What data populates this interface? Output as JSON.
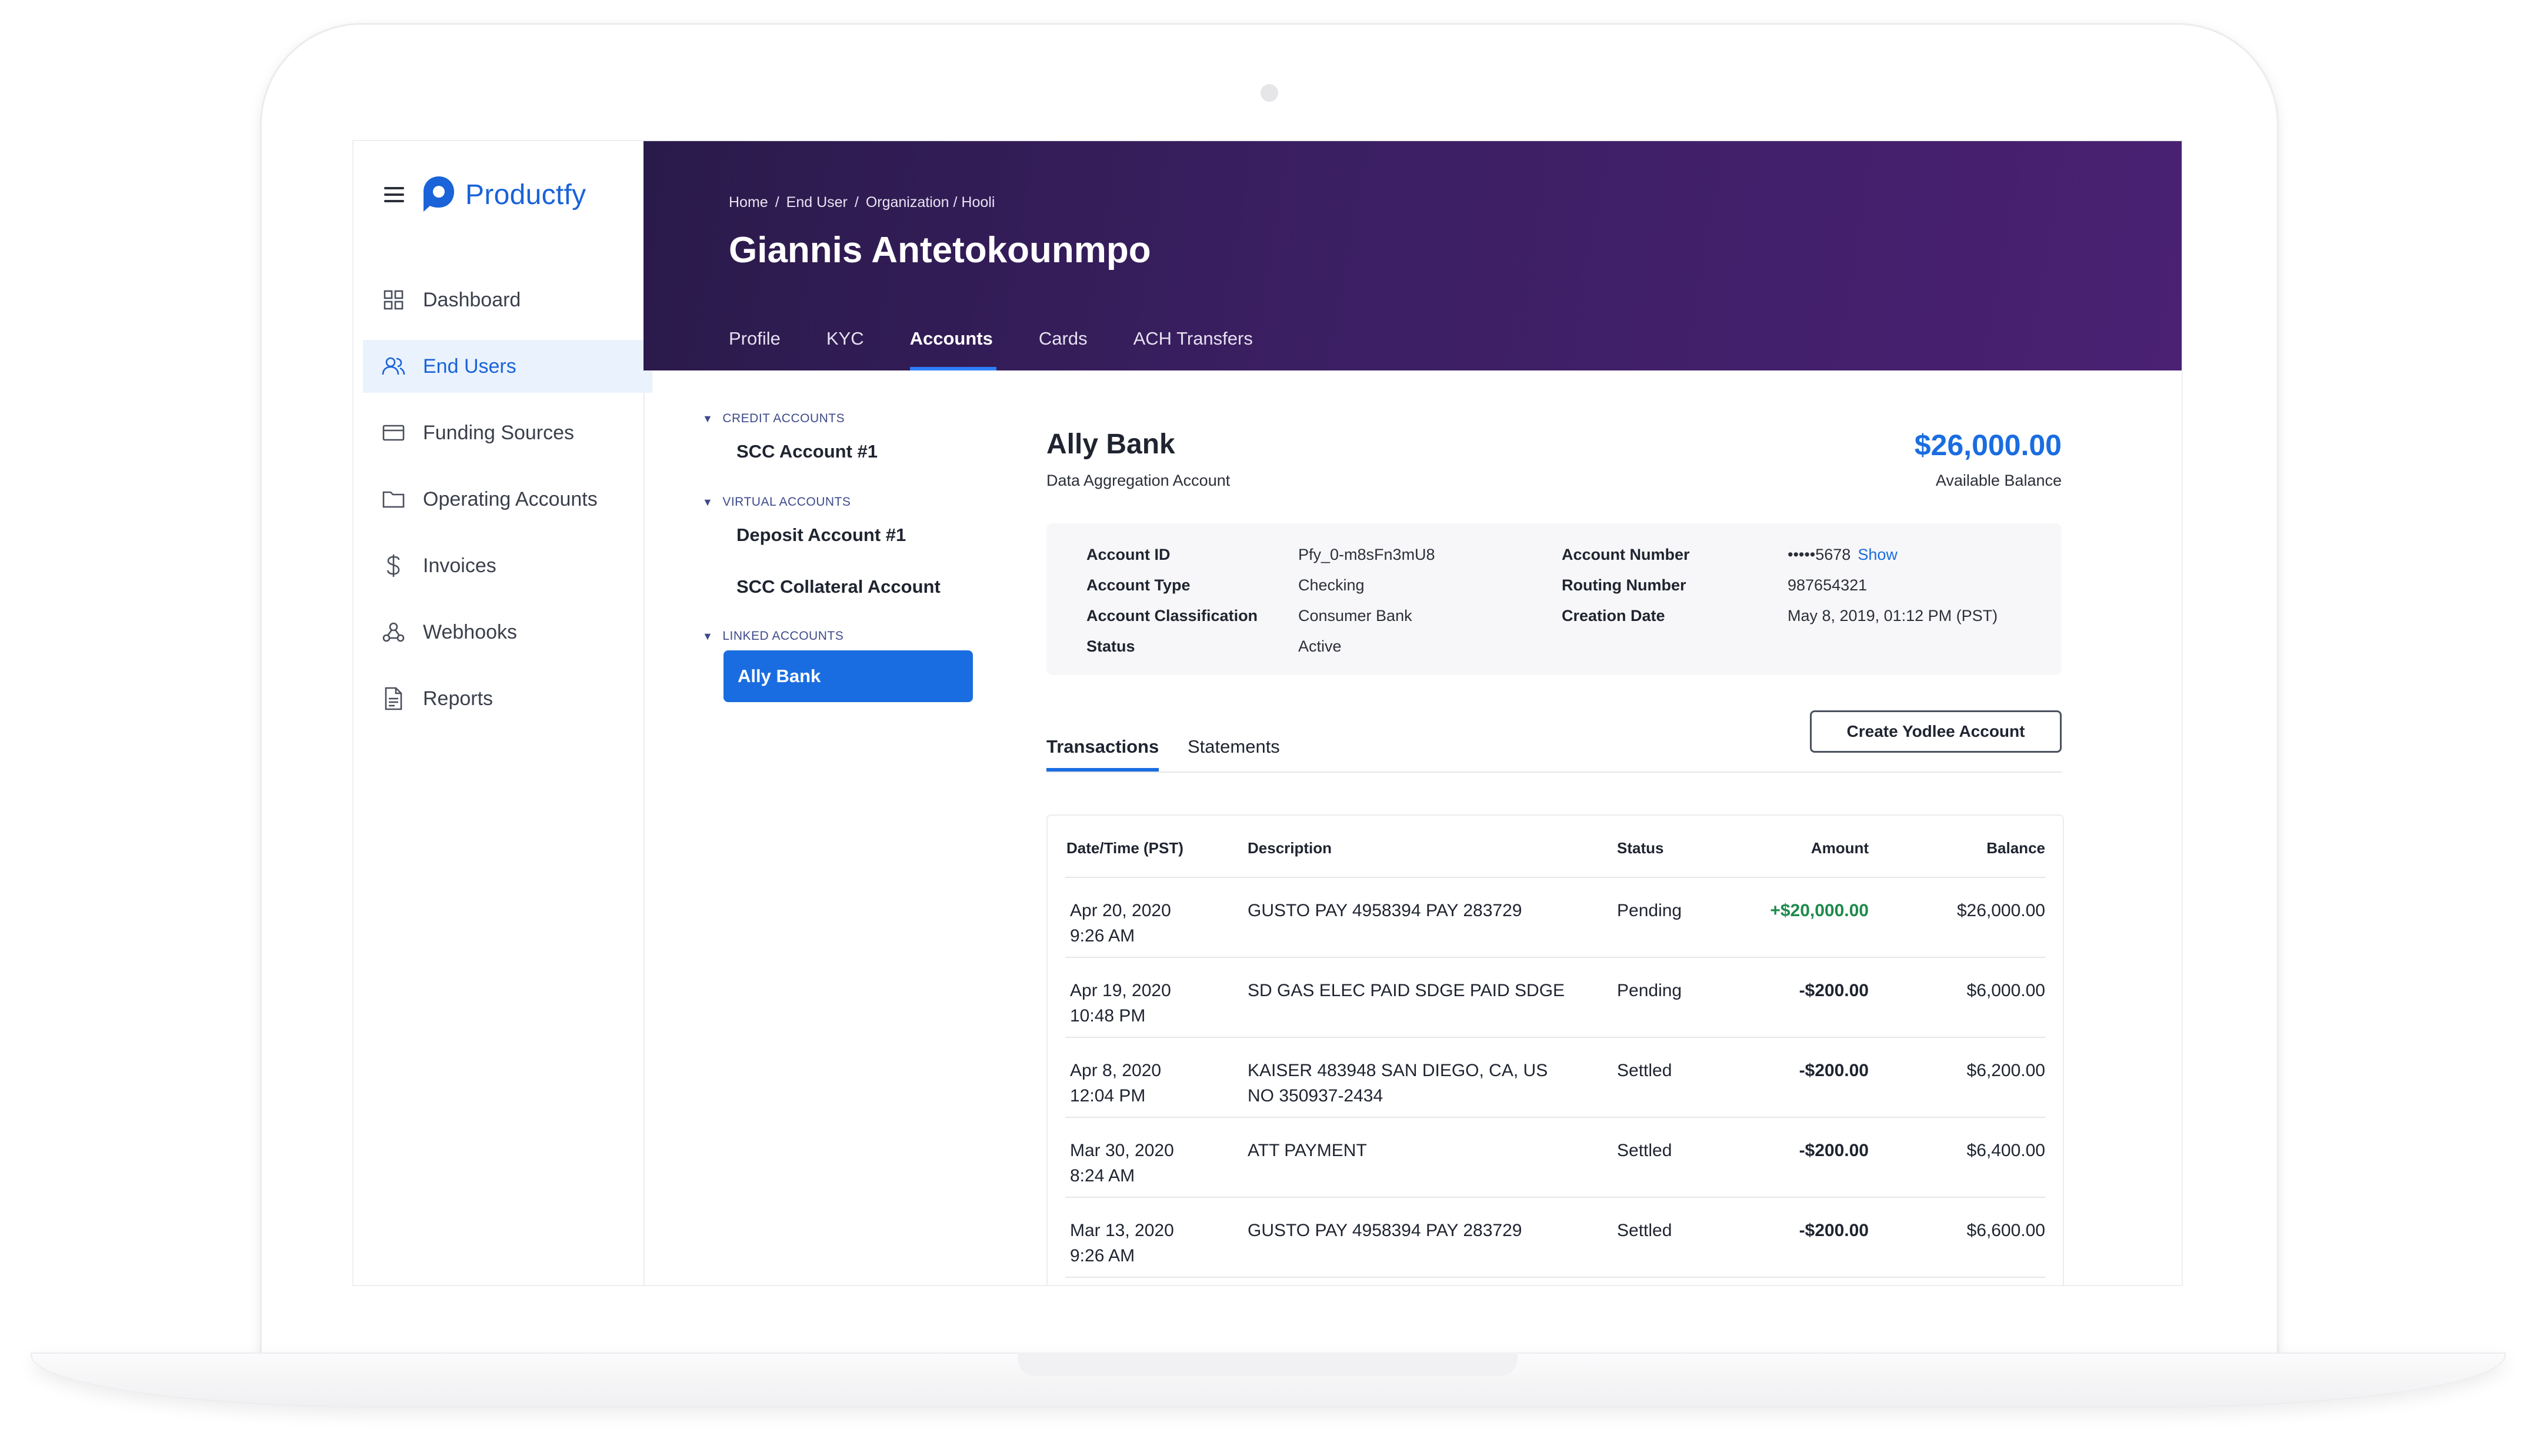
{
  "app": {
    "name": "Productfy"
  },
  "sidebar": {
    "items": [
      {
        "label": "Dashboard",
        "icon": "grid-icon"
      },
      {
        "label": "End Users",
        "icon": "users-icon"
      },
      {
        "label": "Funding Sources",
        "icon": "card-icon"
      },
      {
        "label": "Operating Accounts",
        "icon": "folder-icon"
      },
      {
        "label": "Invoices",
        "icon": "dollar-icon"
      },
      {
        "label": "Webhooks",
        "icon": "webhook-icon"
      },
      {
        "label": "Reports",
        "icon": "document-icon"
      }
    ],
    "active_item": "End Users"
  },
  "header": {
    "breadcrumb": [
      "Home",
      "End User",
      "Organization / Hooli"
    ],
    "title": "Giannis Antetokounmpo",
    "tabs": [
      "Profile",
      "KYC",
      "Accounts",
      "Cards",
      "ACH Transfers"
    ],
    "active_tab": "Accounts"
  },
  "accounts": {
    "groups": [
      {
        "label": "CREDIT ACCOUNTS",
        "items": [
          "SCC Account #1"
        ]
      },
      {
        "label": "VIRTUAL ACCOUNTS",
        "items": [
          "Deposit Account #1",
          "SCC Collateral Account"
        ]
      },
      {
        "label": "LINKED ACCOUNTS",
        "items": [
          "Ally Bank"
        ]
      }
    ],
    "selected": "Ally Bank"
  },
  "account": {
    "name": "Ally Bank",
    "type_label": "Data Aggregation Account",
    "balance": "$26,000.00",
    "balance_label": "Available Balance",
    "details": {
      "account_id_label": "Account ID",
      "account_id": "Pfy_0-m8sFn3mU8",
      "account_type_label": "Account Type",
      "account_type": "Checking",
      "classification_label": "Account Classification",
      "classification": "Consumer Bank",
      "status_label": "Status",
      "status": "Active",
      "account_number_label": "Account Number",
      "account_number": "•••••5678",
      "show_link": "Show",
      "routing_label": "Routing Number",
      "routing": "987654321",
      "creation_label": "Creation Date",
      "creation": "May 8, 2019, 01:12 PM (PST)"
    }
  },
  "subtabs": [
    "Transactions",
    "Statements"
  ],
  "active_subtab": "Transactions",
  "create_button": "Create Yodlee Account",
  "table": {
    "headers": [
      "Date/Time (PST)",
      "Description",
      "Status",
      "Amount",
      "Balance"
    ],
    "rows": [
      {
        "date": "Apr 20, 2020",
        "time": "9:26 AM",
        "desc1": "GUSTO PAY 4958394 PAY 283729",
        "desc2": "",
        "status": "Pending",
        "amount": "+$20,000.00",
        "balance": "$26,000.00"
      },
      {
        "date": "Apr 19, 2020",
        "time": "10:48 PM",
        "desc1": "SD GAS ELEC PAID SDGE PAID SDGE",
        "desc2": "",
        "status": "Pending",
        "amount": "-$200.00",
        "balance": "$6,000.00"
      },
      {
        "date": "Apr 8, 2020",
        "time": "12:04 PM",
        "desc1": "KAISER 483948 SAN DIEGO, CA, US",
        "desc2": "NO 350937-2434",
        "status": "Settled",
        "amount": "-$200.00",
        "balance": "$6,200.00"
      },
      {
        "date": "Mar 30, 2020",
        "time": "8:24 AM",
        "desc1": "ATT PAYMENT",
        "desc2": "",
        "status": "Settled",
        "amount": "-$200.00",
        "balance": "$6,400.00"
      },
      {
        "date": "Mar 13, 2020",
        "time": "9:26 AM",
        "desc1": "GUSTO PAY 4958394 PAY 283729",
        "desc2": "",
        "status": "Settled",
        "amount": "-$200.00",
        "balance": "$6,600.00"
      }
    ]
  },
  "colors": {
    "brand": "#1a63d8",
    "header_start": "#2a1a4a",
    "header_end": "#4a2173",
    "positive": "#1e8a4c"
  }
}
